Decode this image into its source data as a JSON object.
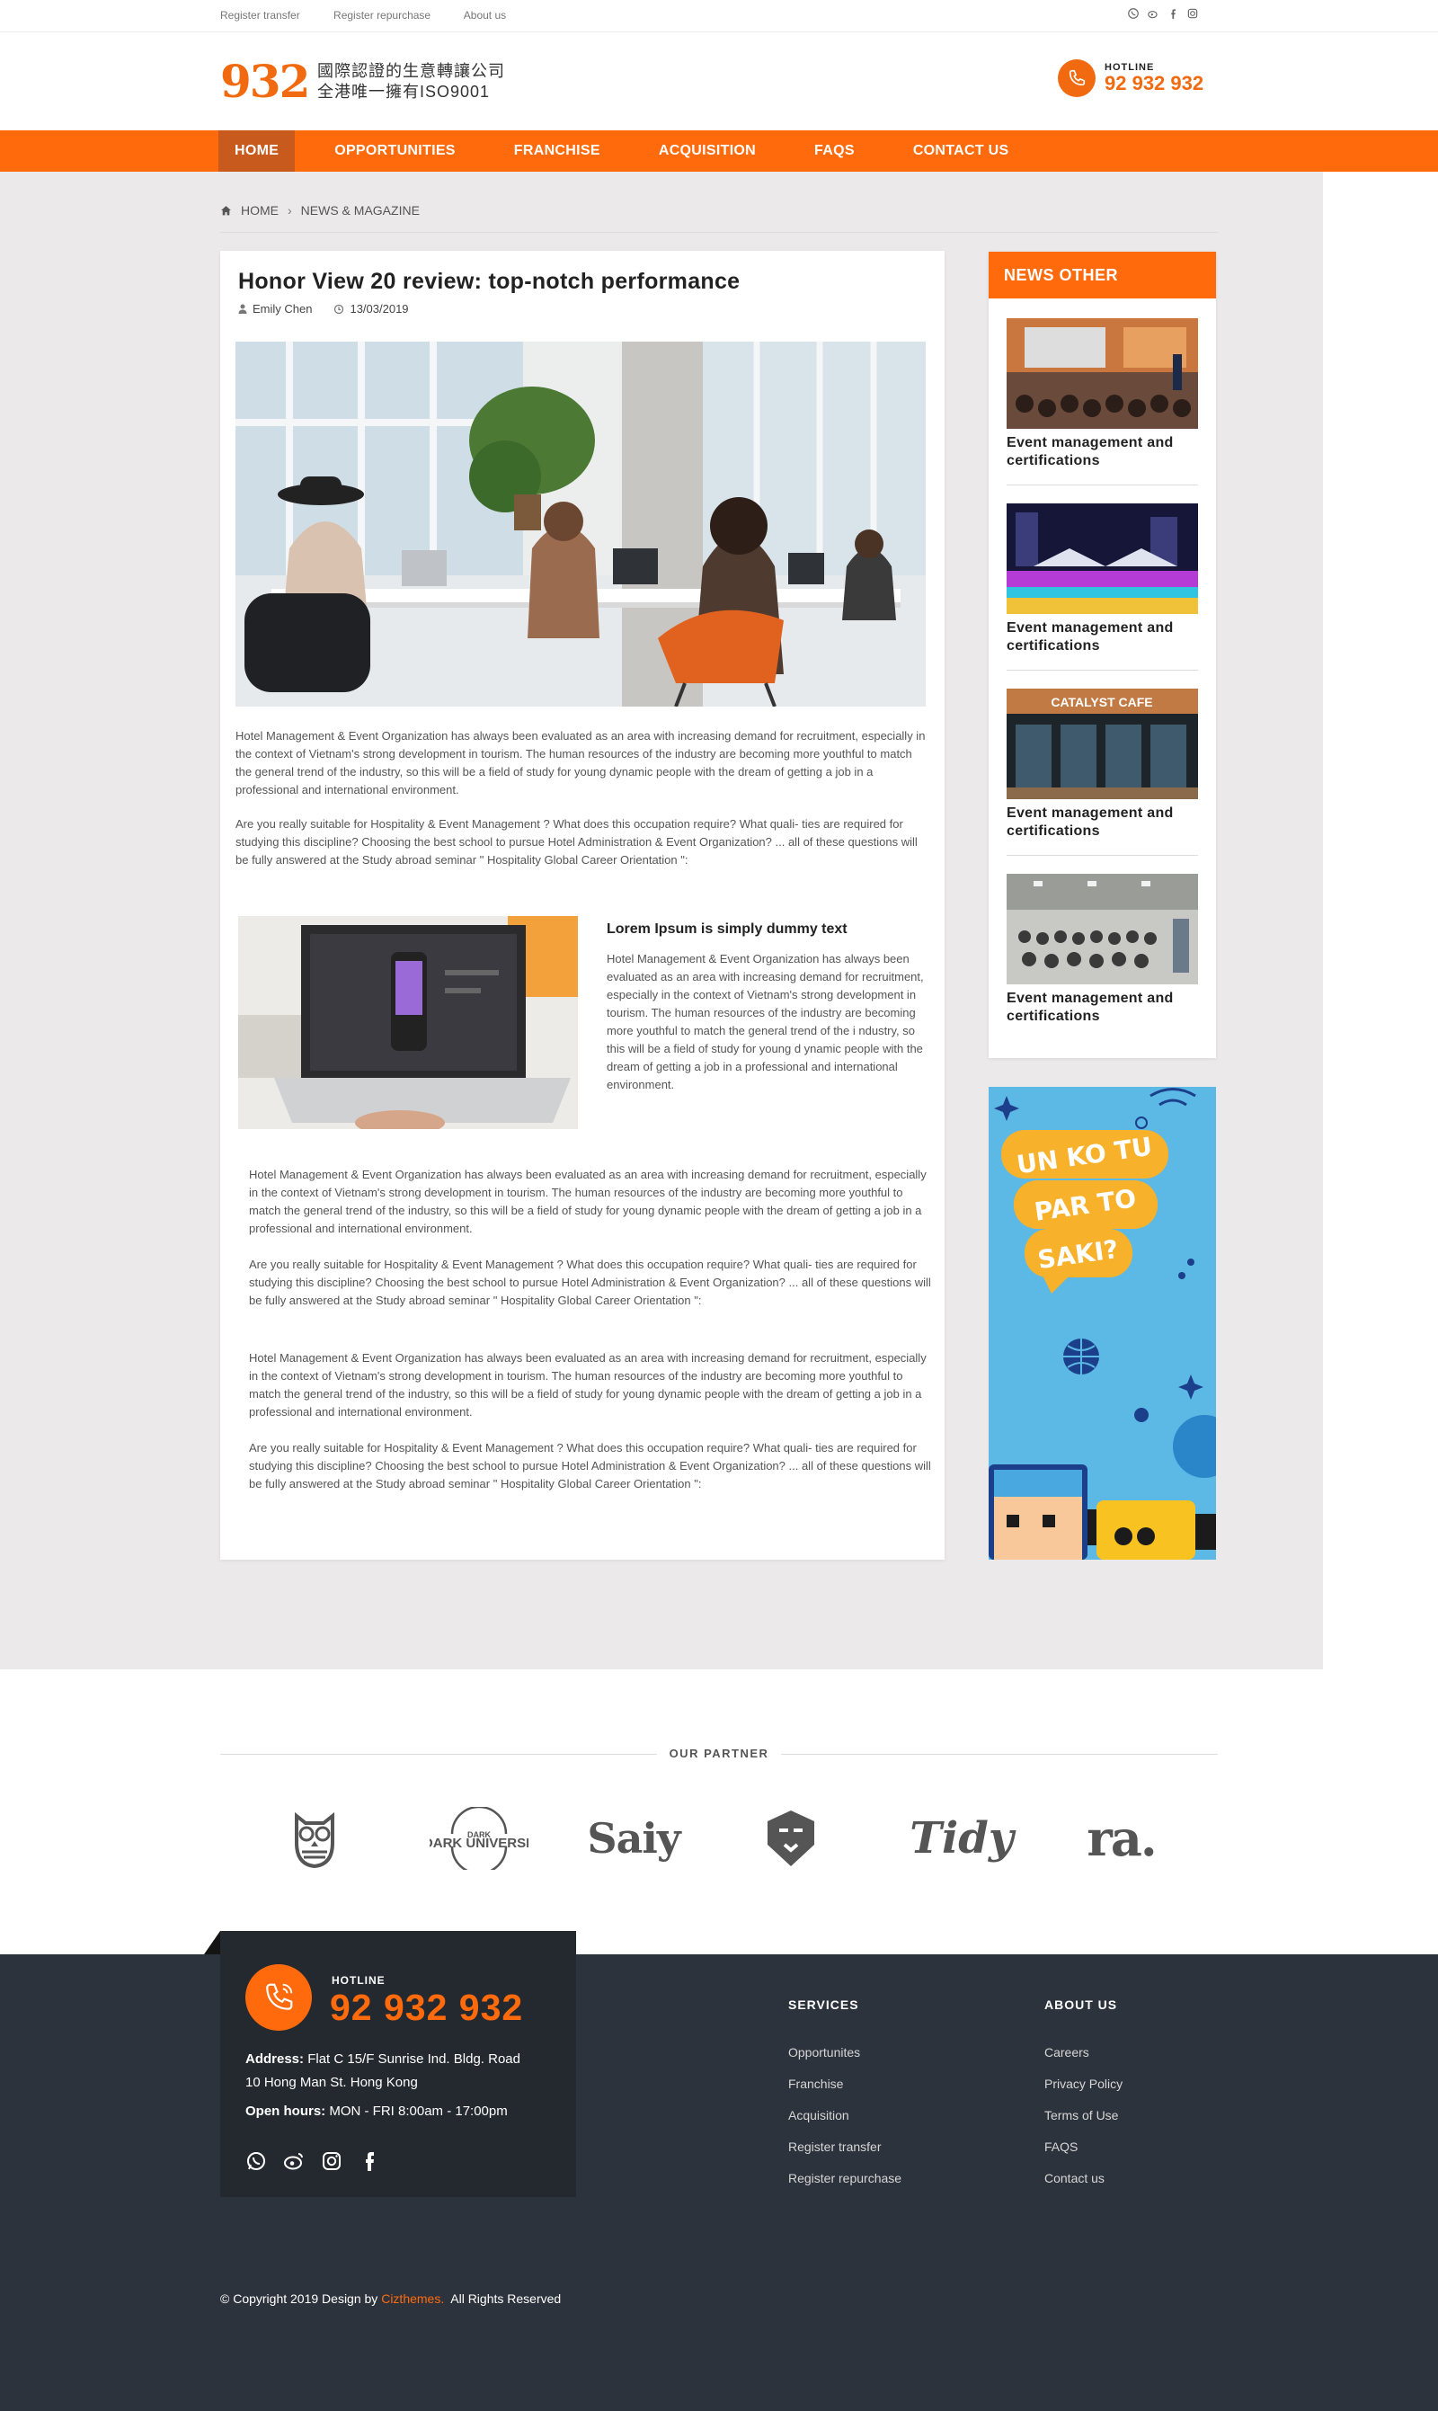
{
  "topbar": {
    "links": [
      "Register transfer",
      "Register repurchase",
      "About us"
    ],
    "social_icons": [
      "whatsapp-icon",
      "weibo-icon",
      "facebook-icon",
      "instagram-icon"
    ]
  },
  "header": {
    "logo_number": "932",
    "logo_line1": "國際認證的生意轉讓公司",
    "logo_line2": "全港唯一擁有ISO9001",
    "hotline_label": "HOTLINE",
    "hotline_number": "92 932 932"
  },
  "nav": {
    "items": [
      {
        "label": "HOME",
        "active": true
      },
      {
        "label": "OPPORTUNITIES"
      },
      {
        "label": "FRANCHISE"
      },
      {
        "label": "ACQUISITION"
      },
      {
        "label": "FAQS"
      },
      {
        "label": "CONTACT US"
      }
    ]
  },
  "breadcrumb": {
    "home": "HOME",
    "current": "NEWS & MAGAZINE"
  },
  "article": {
    "title": "Honor View 20 review: top-notch performance",
    "author": "Emily Chen",
    "date": "13/03/2019",
    "p1": "Hotel Management & Event Organization has always been evaluated as an area with increasing demand for recruitment, especially in the context of Vietnam's strong development in tourism. The human resources of the industry are becoming more youthful to match the general trend of the industry, so this will be a field of study for young dynamic people with the dream of getting a job in a professional and international environment.",
    "p2": "Are you really suitable for  Hospitality & Event Management ? What does this occupation require? What quali- ties are required for studying this discipline? Choosing the best school to pursue Hotel Administration & Event Organization? ... all of these questions will be fully answered at the Study abroad seminar \" Hospitality Global Career Orientation \":",
    "sub_title": "Lorem Ipsum is simply dummy text",
    "sub_p": "Hotel Management & Event Organization has always been evaluated as an area with increasing demand for recruitment, especially in the context of Vietnam's strong development in tourism. The human resources of the industry are becoming more youthful to match the general trend of the i ndustry, so this will be a field of study for young d ynamic people with the dream of getting a job in a professional and international environment.",
    "p3": "Hotel Management & Event Organization has always been evaluated as an area with increasing demand for recruitment, especially in the context of Vietnam's strong development in tourism. The human resources of the industry are becoming more youthful to match the general trend of the industry, so this will be a field of study for young dynamic people with the dream of getting a job in a professional and international environment.",
    "p4": "Are you really suitable for  Hospitality & Event Management ? What does this occupation require? What quali- ties are required for studying this discipline? Choosing the best school to pursue Hotel Administration & Event Organization? ... all of these questions will be fully answered at the Study abroad seminar \" Hospitality Global Career Orientation \":",
    "p5": "Hotel Management & Event Organization has always been evaluated as an area with increasing demand for recruitment, especially in the context of Vietnam's strong development in tourism. The human resources of the industry are becoming more youthful to match the general trend of the industry, so this will be a field of study for young dynamic people with the dream of getting a job in a professional and international environment.",
    "p6": "Are you really suitable for  Hospitality & Event Management ? What does this occupation require? What quali- ties are required for studying this discipline? Choosing the best school to pursue Hotel Administration & Event Organization? ... all of these questions will be fully answered at the Study abroad seminar \" Hospitality Global Career Orientation \":"
  },
  "sidebar": {
    "title": "NEWS OTHER",
    "items": [
      {
        "caption": "Event management and certifications"
      },
      {
        "caption": "Event management and certifications"
      },
      {
        "caption": "Event management and certifications"
      },
      {
        "caption": "Event management and certifications"
      }
    ],
    "thumb3_sign": "CATALYST CAFE",
    "banner_text": [
      "UN KO TU",
      "PAR TO",
      "SAKI?"
    ]
  },
  "partners": {
    "title": "OUR PARTNER",
    "logos": [
      "owl-logo",
      "DARK UNIVERSE",
      "Saiy",
      "lion-logo",
      "Tidy",
      "ra."
    ]
  },
  "footer": {
    "hotline_label": "HOTLINE",
    "hotline_number": "92 932 932",
    "address_label": "Address:",
    "address_line1": "Flat C 15/F Sunrise Ind. Bldg.  Road",
    "address_line2": "10 Hong Man St. Hong Kong",
    "hours_label": "Open hours:",
    "hours_value": "MON - FRI  8:00am - 17:00pm",
    "services_title": "SERVICES",
    "services": [
      "Opportunites",
      "Franchise",
      "Acquisition",
      "Register transfer",
      "Register repurchase"
    ],
    "about_title": "ABOUT US",
    "about": [
      "Careers",
      "Privacy Policy",
      "Terms of Use",
      "FAQS",
      "Contact us"
    ],
    "copyright_prefix": "© Copyright 2019 Design by ",
    "copyright_brand": "Cizthemes.",
    "copyright_suffix": "  All Rights Reserved"
  },
  "colors": {
    "accent": "#ff6a0c",
    "footer_bg": "#2d333c",
    "footer_card": "#24292f",
    "page_bg": "#ebe9ea"
  }
}
